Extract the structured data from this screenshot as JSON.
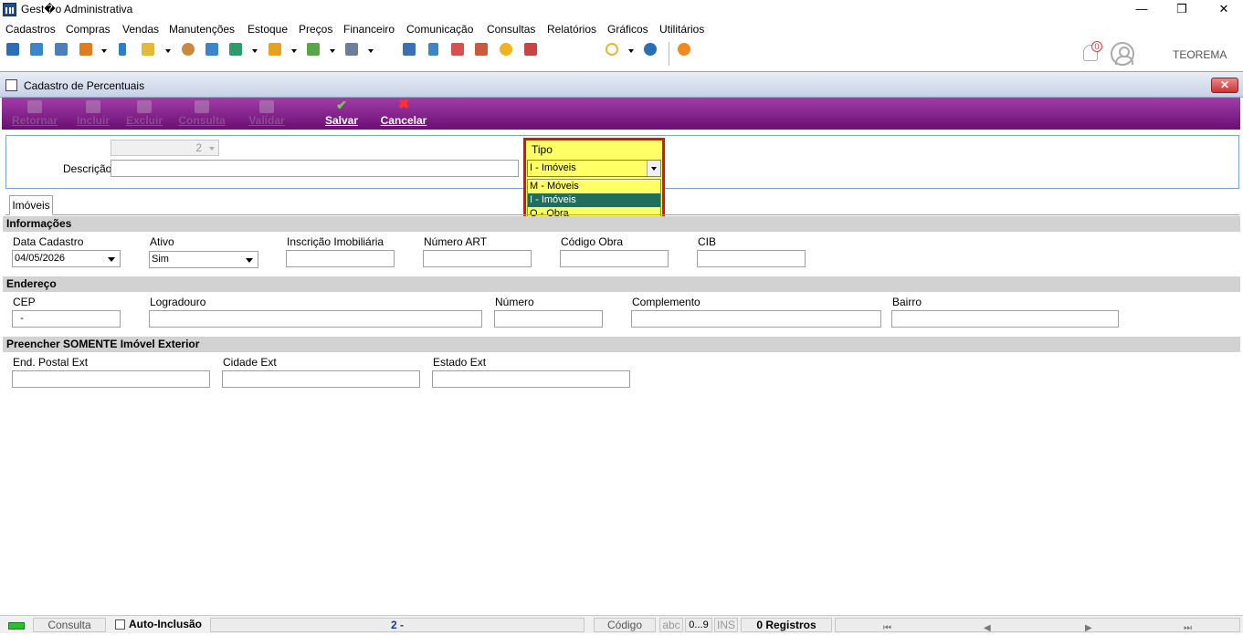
{
  "window": {
    "title": "Gest�o Administrativa",
    "minimize": "—",
    "restore": "❒",
    "close": "✕"
  },
  "menu": [
    "Cadastros",
    "Compras",
    "Vendas",
    "Manutenções",
    "Estoque",
    "Preços",
    "Financeiro",
    "Comunicação",
    "Consultas",
    "Relatórios",
    "Gráficos",
    "Utilitários"
  ],
  "toolbar": {
    "notification_count": "0",
    "user": "TEOREMA"
  },
  "colors": {
    "action_bar": "#8a2391",
    "highlight": "#ffff66",
    "highlight_border": "#e01010",
    "selected_option": "#1f6f5c"
  },
  "child_window": {
    "title": "Cadastro de Percentuais",
    "close": "✕"
  },
  "actions": [
    {
      "label": "Retornar",
      "enabled": false
    },
    {
      "label": "Incluir",
      "enabled": false
    },
    {
      "label": "Excluir",
      "enabled": false
    },
    {
      "label": "Consulta",
      "enabled": false
    },
    {
      "label": "Validar",
      "enabled": false
    },
    {
      "label": "Salvar",
      "enabled": true
    },
    {
      "label": "Cancelar",
      "enabled": true
    }
  ],
  "form": {
    "code_value": "2",
    "descricao_label": "Descrição",
    "descricao_value": "",
    "tipo_label": "Tipo",
    "tipo_value": "I - Imóveis",
    "tipo_options": [
      "M - Móveis",
      "I - Imóveis",
      "O - Obra"
    ],
    "tipo_selected_index": 1
  },
  "tab": {
    "label": "Imóveis"
  },
  "sections": {
    "informacoes": {
      "title": "Informações",
      "data_cadastro_label": "Data Cadastro",
      "data_cadastro_value": "04/05/2026",
      "ativo_label": "Ativo",
      "ativo_value": "Sim",
      "inscricao_label": "Inscrição Imobiliária",
      "art_label": "Número ART",
      "codigo_obra_label": "Código Obra",
      "cib_label": "CIB"
    },
    "endereco": {
      "title": "Endereço",
      "cep_label": "CEP",
      "cep_value": "  -",
      "logradouro_label": "Logradouro",
      "numero_label": "Número",
      "complemento_label": "Complemento",
      "bairro_label": "Bairro"
    },
    "exterior": {
      "title": "Preencher SOMENTE Imóvel Exterior",
      "end_postal_label": "End. Postal Ext",
      "cidade_label": "Cidade Ext",
      "estado_label": "Estado Ext"
    }
  },
  "status": {
    "mode": "Consulta",
    "auto_inclusao": "Auto-Inclusão",
    "record": "2 -",
    "field": "Código",
    "abc": "abc",
    "num": "0...9",
    "ins": "INS",
    "registros": "0 Registros",
    "nav_first": "⏮",
    "nav_prev": "◀",
    "nav_next": "▶",
    "nav_last": "⏭"
  }
}
